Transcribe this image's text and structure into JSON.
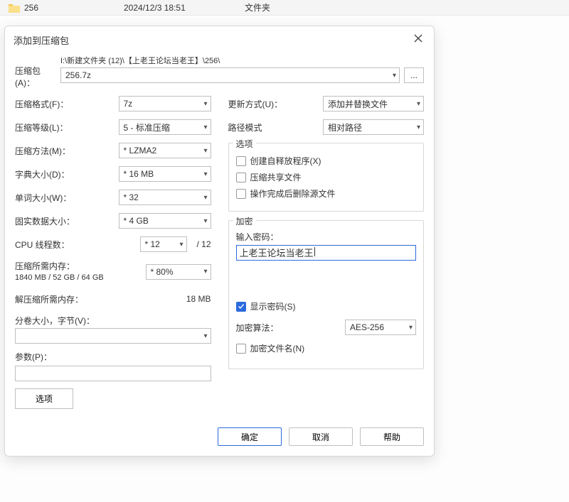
{
  "file_row": {
    "name": "256",
    "date": "2024/12/3 18:51",
    "type": "文件夹"
  },
  "dialog": {
    "title": "添加到压缩包",
    "archive": {
      "label": "压缩包(A)：",
      "path": "I:\\新建文件夹 (12)\\【上老王论坛当老王】\\256\\",
      "value": "256.7z",
      "browse": "..."
    },
    "left": {
      "format": {
        "label": "压缩格式(F)：",
        "value": "7z"
      },
      "level": {
        "label": "压缩等级(L)：",
        "value": "5 - 标准压缩"
      },
      "method": {
        "label": "压缩方法(M)：",
        "value": "* LZMA2"
      },
      "dict": {
        "label": "字典大小(D)：",
        "value": "* 16 MB"
      },
      "word": {
        "label": "单词大小(W)：",
        "value": "* 32"
      },
      "solid": {
        "label": "固实数据大小：",
        "value": "* 4 GB"
      },
      "threads": {
        "label": "CPU 线程数：",
        "value": "* 12",
        "suffix": "/ 12"
      },
      "mem_compress": {
        "label": "压缩所需内存：",
        "sub": "1840 MB / 52 GB / 64 GB",
        "ctrl": "* 80%"
      },
      "mem_decompress": {
        "label": "解压缩所需内存：",
        "value": "18 MB"
      },
      "split": {
        "label": "分卷大小，字节(V)：",
        "value": ""
      },
      "params": {
        "label": "参数(P)：",
        "value": ""
      },
      "options_btn": "选项"
    },
    "right": {
      "update": {
        "label": "更新方式(U)：",
        "value": "添加并替换文件"
      },
      "pathmode": {
        "label": "路径模式",
        "value": "相对路径"
      },
      "opts_legend": "选项",
      "sfx": "创建自释放程序(X)",
      "shared": "压缩共享文件",
      "delafter": "操作完成后删除源文件",
      "enc_legend": "加密",
      "pass_label": "输入密码：",
      "pass_value": "上老王论坛当老王",
      "show_pass": "显示密码(S)",
      "enc_alg": {
        "label": "加密算法：",
        "value": "AES-256"
      },
      "enc_names": "加密文件名(N)"
    },
    "buttons": {
      "ok": "确定",
      "cancel": "取消",
      "help": "帮助"
    }
  }
}
